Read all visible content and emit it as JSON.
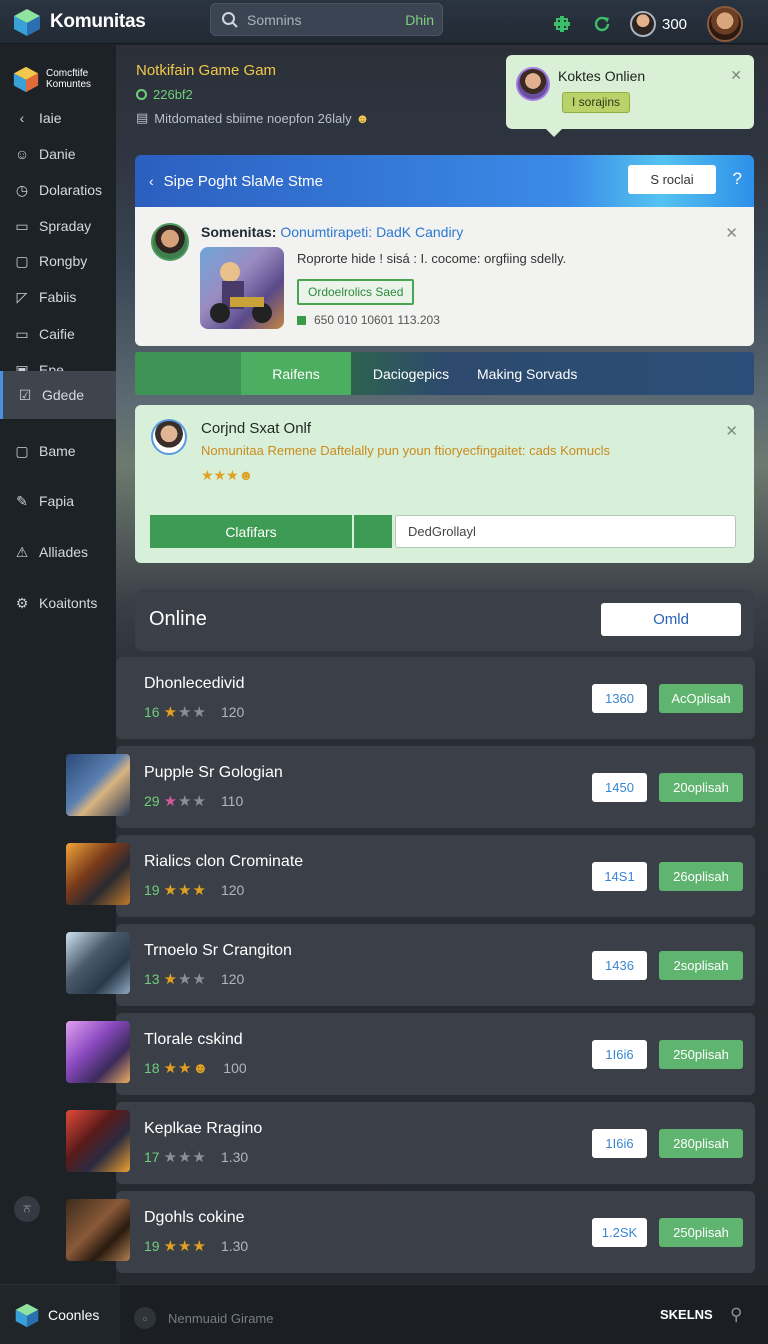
{
  "header": {
    "app_name": "Komunitas",
    "search_placeholder": "Somnins",
    "search_tag": "Dhin",
    "score": "300",
    "icons": [
      "plus-controller-icon",
      "refresh-icon",
      "avatar",
      "profile-avatar"
    ]
  },
  "sidebar": {
    "logo_text": "Comcftife Komuntes",
    "items": [
      {
        "label": "Iaie",
        "icon": "back-arrow-icon"
      },
      {
        "label": "Danie",
        "icon": "smile-icon"
      },
      {
        "label": "Dolaratios",
        "icon": "clock-icon"
      },
      {
        "label": "Spraday",
        "icon": "calendar-icon"
      },
      {
        "label": "Rongby",
        "icon": "box-icon"
      },
      {
        "label": "Fabiis",
        "icon": "folder-icon"
      },
      {
        "label": "Caifie",
        "icon": "chat-icon"
      },
      {
        "label": "Epe",
        "icon": "square-icon"
      },
      {
        "label": "Gdede",
        "icon": "check-icon"
      },
      {
        "label": "Bame",
        "icon": "box-icon"
      },
      {
        "label": "Fapia",
        "icon": "pen-icon"
      },
      {
        "label": "Alliades",
        "icon": "alert-icon"
      },
      {
        "label": "Koaitonts",
        "icon": "group-icon"
      }
    ],
    "bottom_badge": "ਨ"
  },
  "notification": {
    "title": "Notkifain Game Gam",
    "count": "226bf2",
    "line": "Mitdomated sbiime noepfon 26laly"
  },
  "tooltip": {
    "title": "Koktes Onlien",
    "pill": "I sorajins"
  },
  "panel": {
    "back": "‹",
    "title": "Sipe Poght SlaMe Stme",
    "button": "S roclai",
    "help": "?"
  },
  "card": {
    "title_bold": "Somenitas:",
    "title_link": "Oonumtirapeti: DadK Candiry",
    "description": "Roprorte hide ! sisá : I. cocome: orgfiing sdelly.",
    "pill": "Ordoelrolics Saed",
    "meta": "650 010 10601 113.203"
  },
  "tabs": [
    {
      "label": ""
    },
    {
      "label": "Raifens"
    },
    {
      "label": "Daciogepics"
    },
    {
      "label": "Making Sorvads"
    }
  ],
  "chat_card": {
    "title": "Corjnd Sxat Onlf",
    "description": "Nomunitaa Remene Daftelally pun youn ftioryecfingaitet: cads Komucls",
    "stars": "★★★",
    "button": "Clafifars",
    "input_value": "DedGrollayl"
  },
  "online": {
    "label": "Online",
    "button": "Omld"
  },
  "list": [
    {
      "name": "Dhonlecedivid",
      "num": "16",
      "stars": [
        1,
        0,
        0
      ],
      "score": "120",
      "value": "1360",
      "action": "AcOplisah",
      "thumb": "none"
    },
    {
      "name": "Pupple Sr Gologian",
      "num": "29",
      "stars": [
        2,
        0,
        0
      ],
      "score": "110",
      "value": "1450",
      "action": "20oplisah",
      "thumb": "blue"
    },
    {
      "name": "Rialics clon Crominate",
      "num": "19",
      "stars": [
        1,
        1,
        1
      ],
      "score": "120",
      "value": "14S1",
      "action": "26oplisah",
      "thumb": "orange"
    },
    {
      "name": "Trnoelo Sr Crangiton",
      "num": "13",
      "stars": [
        1,
        0,
        0
      ],
      "score": "120",
      "value": "1436",
      "action": "2soplisah",
      "thumb": "steel"
    },
    {
      "name": "Tlorale cskind",
      "num": "18",
      "stars": [
        1,
        1,
        3
      ],
      "score": "100",
      "value": "1I6i6",
      "action": "250plisah",
      "thumb": "purple"
    },
    {
      "name": "Keplkae Rragino",
      "num": "17",
      "stars": [
        0,
        0,
        0
      ],
      "score": "1.30",
      "value": "1I6i6",
      "action": "280plisah",
      "thumb": "red"
    },
    {
      "name": "Dgohls cokine",
      "num": "19",
      "stars": [
        1,
        1,
        1
      ],
      "score": "1.30",
      "value": "1.2SK",
      "action": "250plisah",
      "thumb": "brown"
    }
  ],
  "footer": {
    "brand": "Coonles",
    "search": "Nenmuaid Girame",
    "right": "SKELNS",
    "pin": "⚲"
  }
}
